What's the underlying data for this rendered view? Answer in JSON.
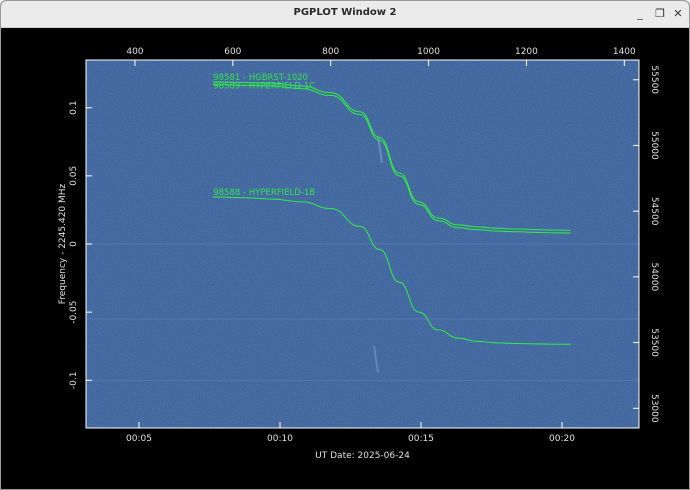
{
  "window": {
    "title": "PGPLOT Window 2",
    "controls": [
      "minimize-icon",
      "restore-icon",
      "close-icon"
    ]
  },
  "colors": {
    "background": "#000000",
    "panel": "#365d97",
    "curve": "#34e24e",
    "axis_text": "#e0e0e0"
  },
  "chart_data": {
    "type": "line",
    "xlabel": "UT Date: 2025-06-24",
    "ylabel": "Frequency - 2245.420 MHz",
    "x_ticks_bottom": [
      "00:05",
      "00:10",
      "00:15",
      "00:20"
    ],
    "x_ticks_top": [
      "400",
      "600",
      "800",
      "1000",
      "1200",
      "1400"
    ],
    "y_ticks_left": [
      "-0.1",
      "-0.05",
      "0",
      "0.05",
      "0.1"
    ],
    "y_ticks_right": [
      "53000",
      "53500",
      "54000",
      "54500",
      "55000",
      "55500"
    ],
    "ylim": [
      -0.135,
      0.135
    ],
    "xlim_top": [
      300,
      1430
    ],
    "ylim_right": [
      52850,
      55650
    ],
    "series": [
      {
        "name": "98581 - HGBRST-1020",
        "x_top": [
          560,
          620,
          680,
          740,
          800,
          860,
          900,
          940,
          980,
          1020,
          1060,
          1100,
          1140,
          1180,
          1220,
          1260,
          1290
        ],
        "values": [
          0.119,
          0.1185,
          0.118,
          0.116,
          0.111,
          0.097,
          0.078,
          0.052,
          0.031,
          0.019,
          0.014,
          0.0125,
          0.0115,
          0.011,
          0.0105,
          0.0102,
          0.01
        ]
      },
      {
        "name": "98589 - HYPERFIELD-1C",
        "x_top": [
          560,
          620,
          680,
          740,
          800,
          860,
          900,
          940,
          980,
          1020,
          1060,
          1100,
          1140,
          1180,
          1220,
          1260,
          1290
        ],
        "values": [
          0.117,
          0.1165,
          0.116,
          0.114,
          0.109,
          0.095,
          0.076,
          0.05,
          0.029,
          0.017,
          0.012,
          0.0105,
          0.0095,
          0.009,
          0.0085,
          0.0082,
          0.008
        ]
      },
      {
        "name": "98588 - HYPERFIELD-1B",
        "x_top": [
          560,
          620,
          680,
          740,
          800,
          860,
          900,
          940,
          980,
          1020,
          1060,
          1100,
          1140,
          1180,
          1220,
          1260,
          1290
        ],
        "values": [
          0.0345,
          0.034,
          0.033,
          0.031,
          0.026,
          0.013,
          -0.004,
          -0.028,
          -0.05,
          -0.063,
          -0.069,
          -0.0715,
          -0.0725,
          -0.073,
          -0.0733,
          -0.0735,
          -0.0736
        ]
      }
    ],
    "grid": false
  }
}
